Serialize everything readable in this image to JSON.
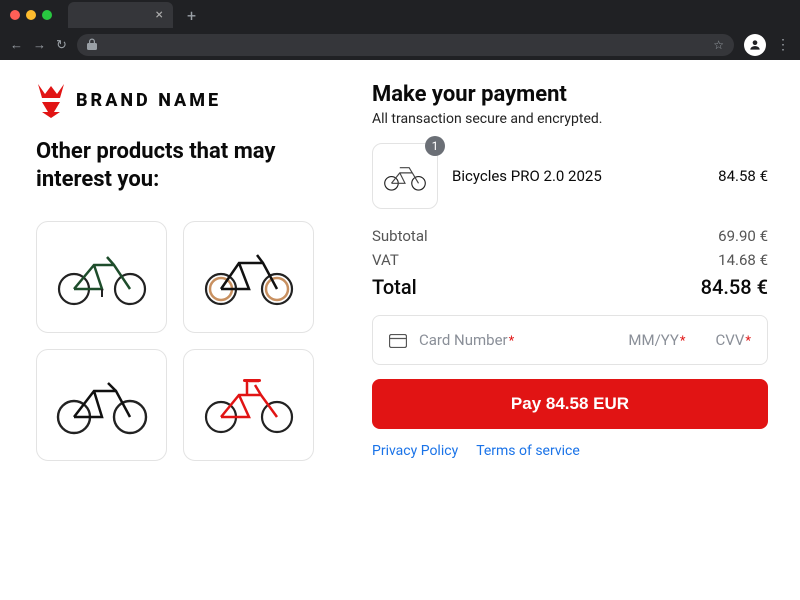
{
  "brand": "BRAND NAME",
  "colors": {
    "accent": "#e11414",
    "link": "#1a73e8"
  },
  "left": {
    "other_products_title": "Other products that may interest you:",
    "cards": [
      {
        "variant": "green"
      },
      {
        "variant": "black-tan"
      },
      {
        "variant": "black"
      },
      {
        "variant": "red"
      }
    ]
  },
  "payment": {
    "title": "Make your payment",
    "subtitle": "All transaction secure and encrypted.",
    "item": {
      "qty": "1",
      "name": "Bicycles PRO 2.0 2025",
      "price": "84.58 €"
    },
    "summary": {
      "subtotal_label": "Subtotal",
      "subtotal_value": "69.90 €",
      "vat_label": "VAT",
      "vat_value": "14.68 €",
      "total_label": "Total",
      "total_value": "84.58 €"
    },
    "card": {
      "number_ph": "Card Number",
      "expiry_ph": "MM/YY",
      "cvv_ph": "CVV",
      "required_mark": "*"
    },
    "button_label": "Pay 84.58 EUR",
    "legal": {
      "privacy": "Privacy Policy",
      "terms": "Terms of service"
    }
  }
}
